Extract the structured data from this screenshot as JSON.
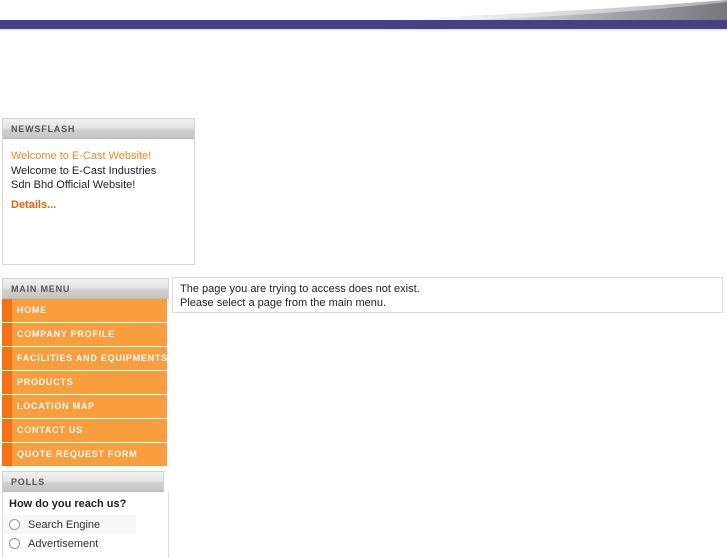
{
  "banner": {
    "bar_color": "#464089",
    "swoosh_color": "#8d8d92",
    "background_color": "#ffffff"
  },
  "newsflash": {
    "heading": "NEWSFLASH",
    "title": "Welcome to E-Cast Website!",
    "line1": "Welcome to E-Cast Industries",
    "line2": "Sdn Bhd Official Website!",
    "details_link": "Details...",
    "title_color": "#f5881f",
    "link_color": "#e8610a"
  },
  "mainmenu": {
    "heading": "MAIN MENU",
    "accent_color": "#fa9d3f",
    "tab_color": "#fa6f11",
    "items": [
      {
        "label": "HOME"
      },
      {
        "label": "COMPANY PROFILE"
      },
      {
        "label": "FACILITIES AND EQUIPMENTS"
      },
      {
        "label": "PRODUCTS"
      },
      {
        "label": "LOCATION MAP"
      },
      {
        "label": "CONTACT US"
      },
      {
        "label": "QUOTE REQUEST FORM"
      }
    ]
  },
  "polls": {
    "heading": "POLLS",
    "question": "How do you reach us?",
    "options": [
      {
        "label": "Search Engine"
      },
      {
        "label": "Advertisement"
      }
    ]
  },
  "content": {
    "line1": "The page you are trying to access does not exist.",
    "line2": "Please select a page from the main menu."
  }
}
